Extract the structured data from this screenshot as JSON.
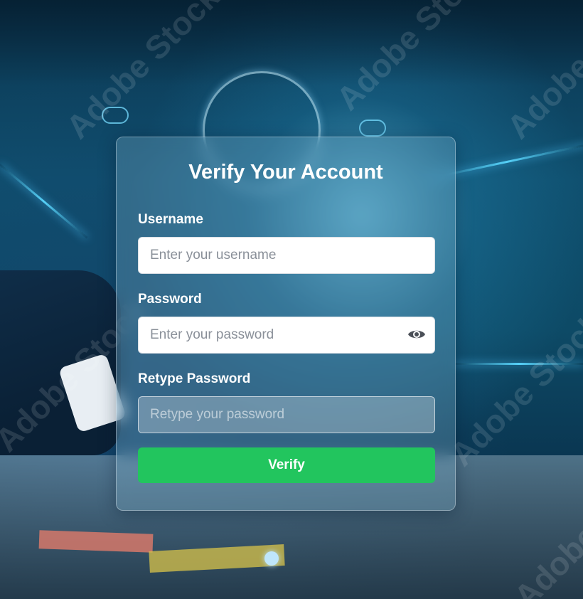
{
  "form": {
    "title": "Verify Your Account",
    "username": {
      "label": "Username",
      "placeholder": "Enter your username",
      "value": ""
    },
    "password": {
      "label": "Password",
      "placeholder": "Enter your password",
      "value": "",
      "toggle_icon": "eye-icon"
    },
    "retype_password": {
      "label": "Retype Password",
      "placeholder": "Retype your password",
      "value": ""
    },
    "submit_label": "Verify"
  },
  "background": {
    "watermark_text": "Adobe Stock"
  },
  "colors": {
    "accent_button": "#22c55e",
    "title_text": "#ffffff",
    "background_primary": "#0f4f6e"
  }
}
